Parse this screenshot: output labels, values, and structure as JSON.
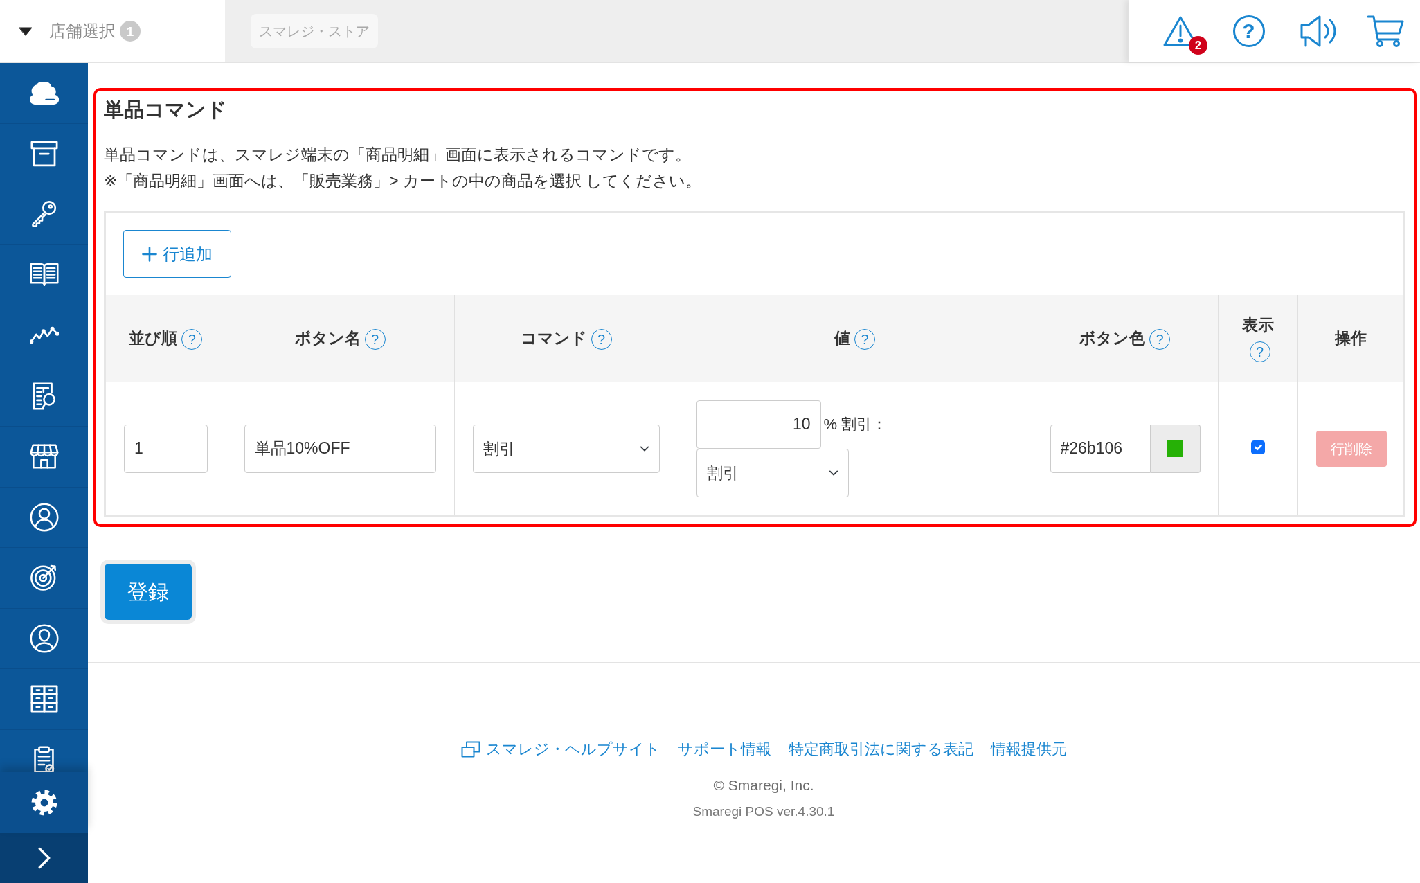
{
  "header": {
    "store_select": {
      "label": "店舗選択",
      "count": "1"
    },
    "store_name": "スマレジ・ストア",
    "icons": [
      {
        "kind": "warning",
        "badge": "2"
      },
      {
        "kind": "help",
        "glyph": "?"
      },
      {
        "kind": "megaphone"
      },
      {
        "kind": "cart"
      }
    ]
  },
  "sidebar": {
    "items": [
      {
        "kind": "cloud"
      },
      {
        "kind": "archive"
      },
      {
        "kind": "key"
      },
      {
        "kind": "book"
      },
      {
        "kind": "trend"
      },
      {
        "kind": "report"
      },
      {
        "kind": "store"
      },
      {
        "kind": "person"
      },
      {
        "kind": "target"
      },
      {
        "kind": "user"
      },
      {
        "kind": "cabinet"
      },
      {
        "kind": "clipboard"
      }
    ],
    "footer": [
      {
        "kind": "gear"
      },
      {
        "kind": "chevron"
      }
    ]
  },
  "section": {
    "highlighted": true,
    "title": "単品コマンド",
    "description": [
      "単品コマンドは、スマレジ端末の「商品明細」画面に表示されるコマンドです。",
      "※「商品明細」画面へは、「販売業務」> カートの中の商品を選択 してください。"
    ],
    "add_row_button": "行追加",
    "table": {
      "columns": [
        {
          "label": "並び順",
          "help": "?"
        },
        {
          "label": "ボタン名",
          "help": "?"
        },
        {
          "label": "コマンド",
          "help": "?"
        },
        {
          "label": "値",
          "help": "?"
        },
        {
          "label": "ボタン色",
          "help": "?"
        },
        {
          "label": "表示",
          "help": "?"
        },
        {
          "label": "操作"
        }
      ],
      "rows": [
        {
          "order": "1",
          "button_name": "単品10%OFF",
          "command": "割引",
          "value": {
            "amount": "10",
            "label": "% 割引：",
            "type": "割引"
          },
          "button_color": "#26b106",
          "visible": true,
          "delete": {
            "label": "行削除",
            "disabled": true
          }
        }
      ]
    }
  },
  "register_button": "登録",
  "footer": {
    "links": [
      {
        "label": "スマレジ・ヘルプサイト",
        "external": true
      },
      {
        "label": "サポート情報",
        "external": false
      },
      {
        "label": "特定商取引法に関する表記",
        "external": false
      },
      {
        "label": "情報提供元",
        "external": false
      }
    ],
    "copyright": "© Smaregi, Inc.",
    "version": "Smaregi POS ver.4.30.1"
  }
}
